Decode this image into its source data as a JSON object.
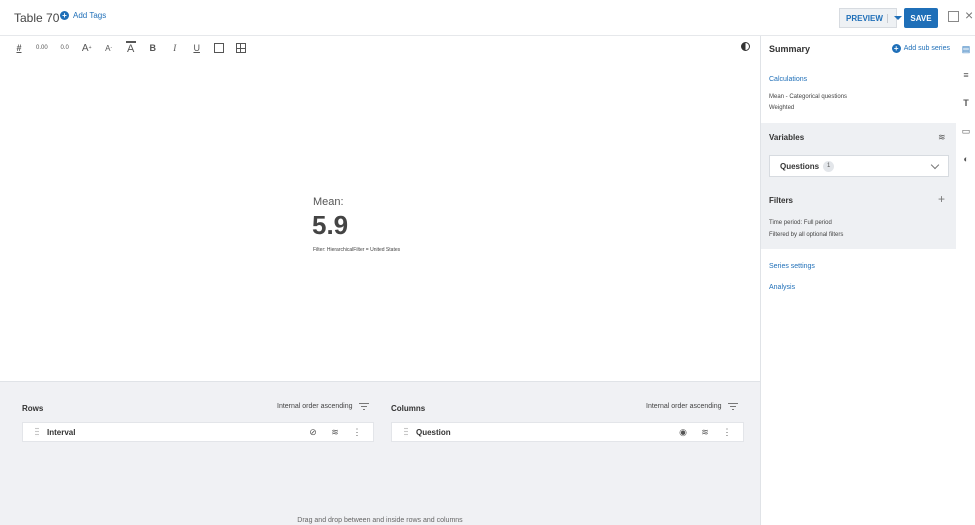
{
  "header": {
    "title": "Table 70",
    "add_tags": "Add Tags",
    "preview": "PREVIEW",
    "save": "SAVE"
  },
  "toolbar": {
    "decrease_decimals": "0.00",
    "increase_decimals": "0.0",
    "bold": "B",
    "italic": "I",
    "underline": "U"
  },
  "canvas": {
    "label": "Mean:",
    "value": "5.9",
    "filter": "Filter: HierarchicalFilter = United States"
  },
  "rows": {
    "title": "Rows",
    "order": "Internal order ascending",
    "item": "Interval"
  },
  "columns": {
    "title": "Columns",
    "order": "Internal order ascending",
    "item": "Question"
  },
  "panel_hint": "Drag and drop between and inside rows and columns",
  "sidebar": {
    "title": "Summary",
    "add_sub_series": "Add sub series",
    "calculations_link": "Calculations",
    "calc_line1": "Mean - Categorical questions",
    "calc_line2": "Weighted",
    "variables_title": "Variables",
    "questions_label": "Questions",
    "questions_count": "1",
    "filters_title": "Filters",
    "filters_line1": "Time period: Full period",
    "filters_line2": "Filtered by all optional filters",
    "series_settings": "Series settings",
    "analysis": "Analysis"
  },
  "colors": {
    "accent": "#1f6fb8",
    "panel_bg": "#f0f1f4"
  }
}
